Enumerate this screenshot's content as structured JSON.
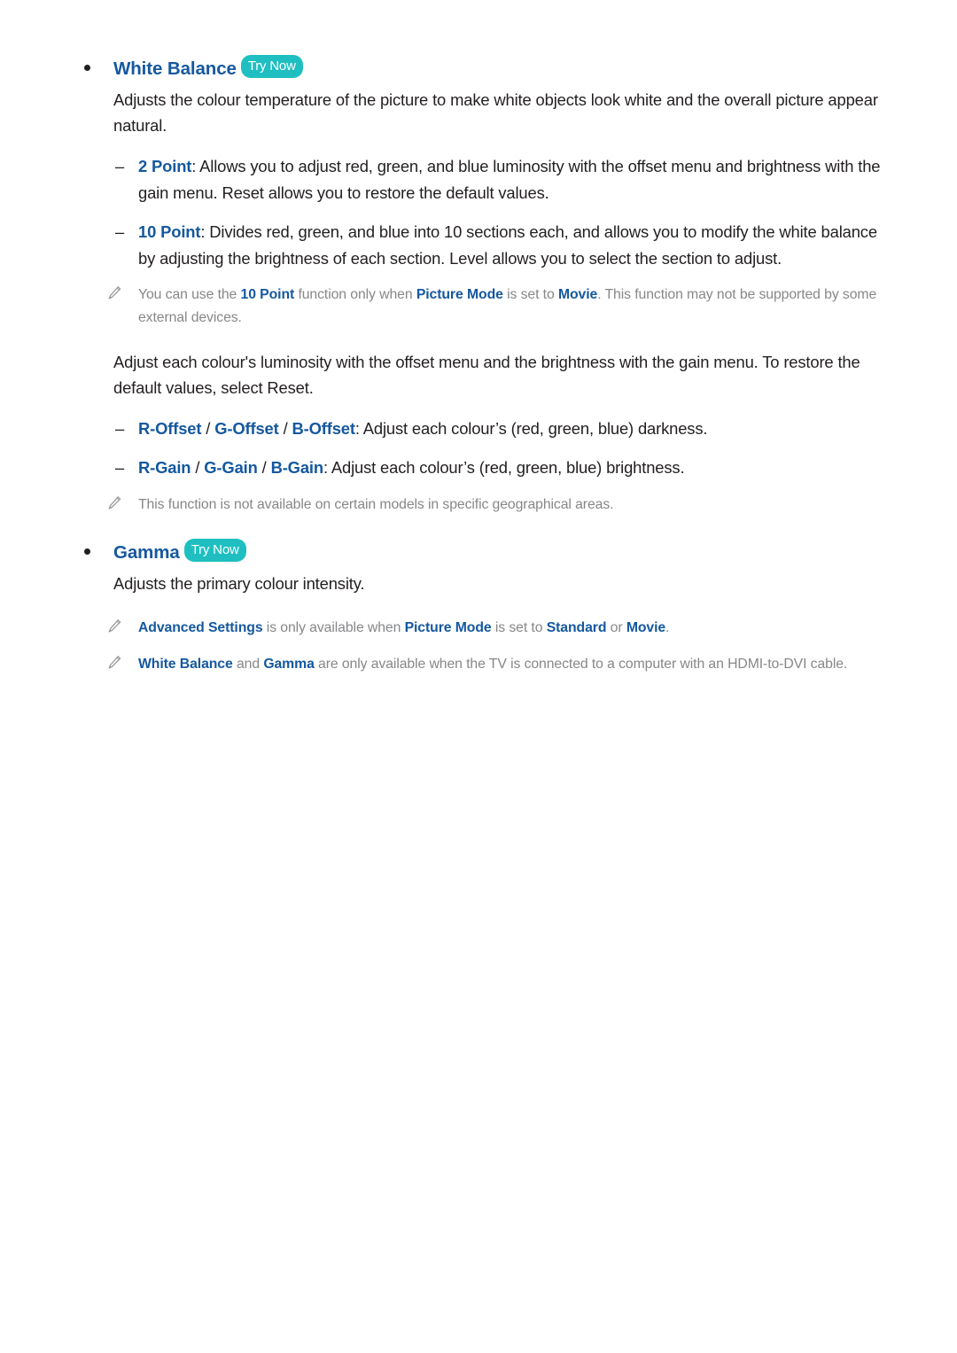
{
  "page": {
    "sections": [
      {
        "id": "white-balance",
        "heading": "White Balance",
        "badge": "Try Now",
        "intro": "Adjusts the colour temperature of the picture to make white objects look white and the overall picture appear natural.",
        "items": [
          {
            "term": "2 Point",
            "body": ": Allows you to adjust red, green, and blue luminosity with the offset menu and brightness with the gain menu. Reset allows you to restore the default values."
          },
          {
            "term": "10 Point",
            "body": ": Divides red, green, and blue into 10 sections each, and allows you to modify the white balance by adjusting the brightness of each section. Level allows you to select the section to adjust."
          }
        ],
        "note_10point": {
          "t1": "You can use the ",
          "b1": "10 Point",
          "t2": " function only when ",
          "b2": "Picture Mode",
          "t3": " is set to ",
          "b3": "Movie",
          "t4": ". This function may not be supported by some external devices."
        },
        "body2": "Adjust each colour's luminosity with the offset menu and the brightness with the gain menu. To restore the default values, select Reset.",
        "offset_item": {
          "t1": "R-Offset",
          "s1": " / ",
          "t2": "G-Offset",
          "s2": " / ",
          "t3": "B-Offset",
          "body": ": Adjust each colour’s (red, green, blue) darkness."
        },
        "gain_item": {
          "t1": "R-Gain",
          "s1": " / ",
          "t2": "G-Gain",
          "s2": " / ",
          "t3": "B-Gain",
          "body": ": Adjust each colour’s (red, green, blue) brightness."
        },
        "note_region": "This function is not available on certain models in specific geographical areas."
      },
      {
        "id": "gamma",
        "heading": "Gamma",
        "badge": "Try Now",
        "intro": "Adjusts the primary colour intensity.",
        "note_advanced": {
          "b1": "Advanced Settings",
          "t1": " is only available when ",
          "b2": "Picture Mode",
          "t2": " is set to ",
          "b3": "Standard",
          "t3": " or ",
          "b4": "Movie",
          "t4": "."
        },
        "note_hdmi": {
          "b1": "White Balance",
          "t1": " and ",
          "b2": "Gamma",
          "t2": " are only available when the TV is connected to a computer with an HDMI-to-DVI cable."
        }
      }
    ],
    "markers": {
      "bullet": "•",
      "dash": "–"
    },
    "colors": {
      "heading_blue": "#15589f",
      "badge_teal": "#1fbfc1",
      "note_gray": "#868789",
      "body_black": "#231f20"
    },
    "icons": {
      "note": "pencil-icon"
    }
  }
}
